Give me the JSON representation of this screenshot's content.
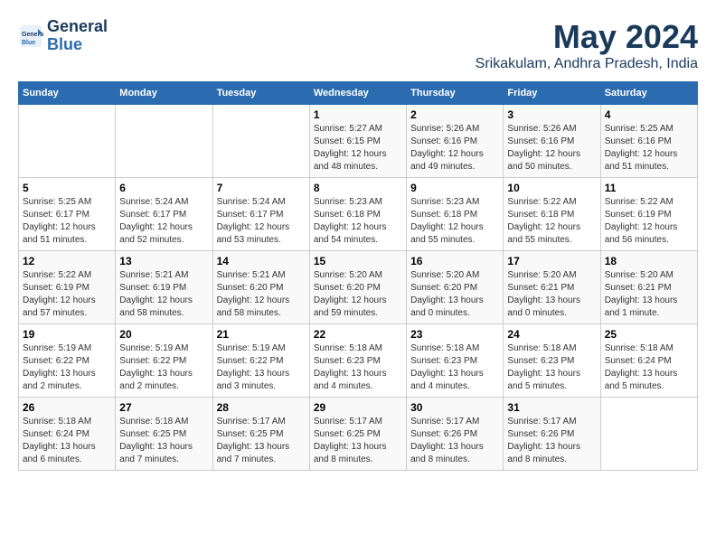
{
  "header": {
    "logo_line1": "General",
    "logo_line2": "Blue",
    "month_title": "May 2024",
    "subtitle": "Srikakulam, Andhra Pradesh, India"
  },
  "days_of_week": [
    "Sunday",
    "Monday",
    "Tuesday",
    "Wednesday",
    "Thursday",
    "Friday",
    "Saturday"
  ],
  "weeks": [
    [
      {
        "day": "",
        "info": ""
      },
      {
        "day": "",
        "info": ""
      },
      {
        "day": "",
        "info": ""
      },
      {
        "day": "1",
        "info": "Sunrise: 5:27 AM\nSunset: 6:15 PM\nDaylight: 12 hours\nand 48 minutes."
      },
      {
        "day": "2",
        "info": "Sunrise: 5:26 AM\nSunset: 6:16 PM\nDaylight: 12 hours\nand 49 minutes."
      },
      {
        "day": "3",
        "info": "Sunrise: 5:26 AM\nSunset: 6:16 PM\nDaylight: 12 hours\nand 50 minutes."
      },
      {
        "day": "4",
        "info": "Sunrise: 5:25 AM\nSunset: 6:16 PM\nDaylight: 12 hours\nand 51 minutes."
      }
    ],
    [
      {
        "day": "5",
        "info": "Sunrise: 5:25 AM\nSunset: 6:17 PM\nDaylight: 12 hours\nand 51 minutes."
      },
      {
        "day": "6",
        "info": "Sunrise: 5:24 AM\nSunset: 6:17 PM\nDaylight: 12 hours\nand 52 minutes."
      },
      {
        "day": "7",
        "info": "Sunrise: 5:24 AM\nSunset: 6:17 PM\nDaylight: 12 hours\nand 53 minutes."
      },
      {
        "day": "8",
        "info": "Sunrise: 5:23 AM\nSunset: 6:18 PM\nDaylight: 12 hours\nand 54 minutes."
      },
      {
        "day": "9",
        "info": "Sunrise: 5:23 AM\nSunset: 6:18 PM\nDaylight: 12 hours\nand 55 minutes."
      },
      {
        "day": "10",
        "info": "Sunrise: 5:22 AM\nSunset: 6:18 PM\nDaylight: 12 hours\nand 55 minutes."
      },
      {
        "day": "11",
        "info": "Sunrise: 5:22 AM\nSunset: 6:19 PM\nDaylight: 12 hours\nand 56 minutes."
      }
    ],
    [
      {
        "day": "12",
        "info": "Sunrise: 5:22 AM\nSunset: 6:19 PM\nDaylight: 12 hours\nand 57 minutes."
      },
      {
        "day": "13",
        "info": "Sunrise: 5:21 AM\nSunset: 6:19 PM\nDaylight: 12 hours\nand 58 minutes."
      },
      {
        "day": "14",
        "info": "Sunrise: 5:21 AM\nSunset: 6:20 PM\nDaylight: 12 hours\nand 58 minutes."
      },
      {
        "day": "15",
        "info": "Sunrise: 5:20 AM\nSunset: 6:20 PM\nDaylight: 12 hours\nand 59 minutes."
      },
      {
        "day": "16",
        "info": "Sunrise: 5:20 AM\nSunset: 6:20 PM\nDaylight: 13 hours\nand 0 minutes."
      },
      {
        "day": "17",
        "info": "Sunrise: 5:20 AM\nSunset: 6:21 PM\nDaylight: 13 hours\nand 0 minutes."
      },
      {
        "day": "18",
        "info": "Sunrise: 5:20 AM\nSunset: 6:21 PM\nDaylight: 13 hours\nand 1 minute."
      }
    ],
    [
      {
        "day": "19",
        "info": "Sunrise: 5:19 AM\nSunset: 6:22 PM\nDaylight: 13 hours\nand 2 minutes."
      },
      {
        "day": "20",
        "info": "Sunrise: 5:19 AM\nSunset: 6:22 PM\nDaylight: 13 hours\nand 2 minutes."
      },
      {
        "day": "21",
        "info": "Sunrise: 5:19 AM\nSunset: 6:22 PM\nDaylight: 13 hours\nand 3 minutes."
      },
      {
        "day": "22",
        "info": "Sunrise: 5:18 AM\nSunset: 6:23 PM\nDaylight: 13 hours\nand 4 minutes."
      },
      {
        "day": "23",
        "info": "Sunrise: 5:18 AM\nSunset: 6:23 PM\nDaylight: 13 hours\nand 4 minutes."
      },
      {
        "day": "24",
        "info": "Sunrise: 5:18 AM\nSunset: 6:23 PM\nDaylight: 13 hours\nand 5 minutes."
      },
      {
        "day": "25",
        "info": "Sunrise: 5:18 AM\nSunset: 6:24 PM\nDaylight: 13 hours\nand 5 minutes."
      }
    ],
    [
      {
        "day": "26",
        "info": "Sunrise: 5:18 AM\nSunset: 6:24 PM\nDaylight: 13 hours\nand 6 minutes."
      },
      {
        "day": "27",
        "info": "Sunrise: 5:18 AM\nSunset: 6:25 PM\nDaylight: 13 hours\nand 7 minutes."
      },
      {
        "day": "28",
        "info": "Sunrise: 5:17 AM\nSunset: 6:25 PM\nDaylight: 13 hours\nand 7 minutes."
      },
      {
        "day": "29",
        "info": "Sunrise: 5:17 AM\nSunset: 6:25 PM\nDaylight: 13 hours\nand 8 minutes."
      },
      {
        "day": "30",
        "info": "Sunrise: 5:17 AM\nSunset: 6:26 PM\nDaylight: 13 hours\nand 8 minutes."
      },
      {
        "day": "31",
        "info": "Sunrise: 5:17 AM\nSunset: 6:26 PM\nDaylight: 13 hours\nand 8 minutes."
      },
      {
        "day": "",
        "info": ""
      }
    ]
  ]
}
